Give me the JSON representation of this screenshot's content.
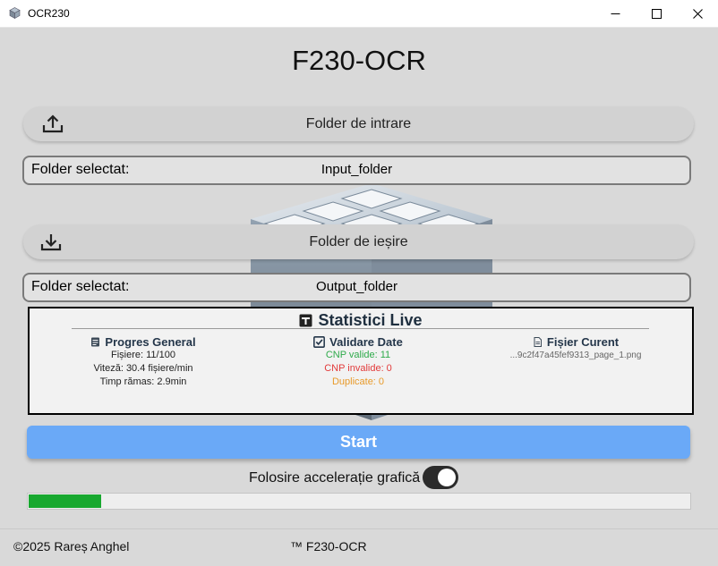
{
  "window": {
    "title": "OCR230",
    "app_icon": "cube-icon",
    "controls": [
      "minimize-icon",
      "maximize-icon",
      "close-icon"
    ]
  },
  "app": {
    "title": "F230-OCR"
  },
  "input": {
    "button_label": "Folder de intrare",
    "button_icon": "upload-icon",
    "field_label": "Folder selectat:",
    "field_value": "Input_folder"
  },
  "output": {
    "button_label": "Folder de ieșire",
    "button_icon": "download-icon",
    "field_label": "Folder selectat:",
    "field_value": "Output_folder"
  },
  "stats": {
    "title": "Statistici Live",
    "title_icon": "stats-icon",
    "progress": {
      "heading": "Progres General",
      "icon": "progress-icon",
      "files": "Fișiere: 11/100",
      "speed": "Viteză: 30.4 fișiere/min",
      "remaining": "Timp rămas: 2.9min"
    },
    "validation": {
      "heading": "Validare Date",
      "icon": "checkbox-icon",
      "valid": "CNP valide: 11",
      "invalid": "CNP invalide: 0",
      "duplicates": "Duplicate: 0"
    },
    "current_file": {
      "heading": "Fișier Curent",
      "icon": "file-icon",
      "name": "...9c2f47a45fef9313_page_1.png"
    }
  },
  "start_label": "Start",
  "gpu": {
    "label": "Folosire accelerație grafică",
    "enabled": true
  },
  "progress_fraction": 0.11,
  "footer": {
    "copyright": "©2025 Rareș Anghel",
    "brand": "™ F230-OCR"
  },
  "colors": {
    "accent": "#6aa9f7",
    "progress": "#18a82f",
    "valid": "#2eaa4a",
    "invalid": "#e23a3a",
    "duplicate": "#e89a2a"
  }
}
